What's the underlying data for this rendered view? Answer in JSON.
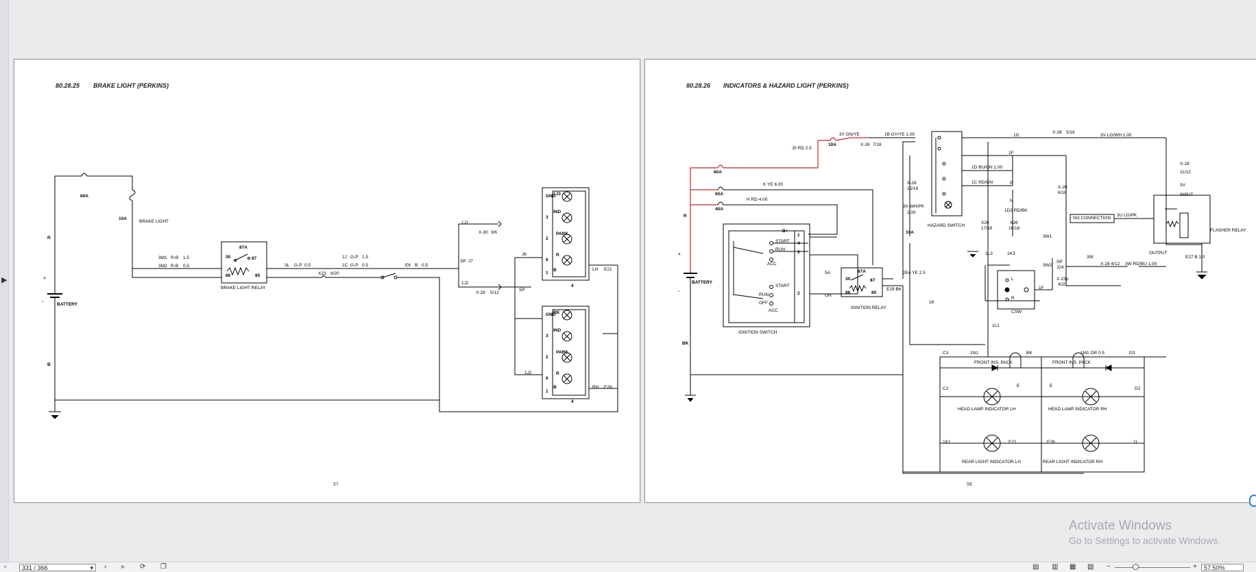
{
  "viewer": {
    "page_input": "331 / 366",
    "zoom": "57.50%"
  },
  "watermark": {
    "title": "Activate Windows",
    "subtitle": "Go to Settings to activate Windows."
  },
  "pages": [
    {
      "code": "80.28.25",
      "title": "BRAKE LIGHT (PERKINS)",
      "number": "57",
      "labels": [
        "60A",
        "10A",
        "BRAKE LIGHT",
        "R",
        "+",
        "-",
        "BATTERY",
        "B",
        "3M1",
        "R-B",
        "1.5",
        "3M2",
        "R-B",
        "0.5",
        "87A",
        "30",
        "87",
        "86",
        "85",
        "BRAKE LIGHT RELAY",
        "3L",
        "G-P",
        "0.5",
        "X23",
        "6/20",
        "1J",
        "G-P",
        "1.5",
        "1C",
        "G-P",
        "0.5",
        "E6",
        "B",
        "0.5",
        "1J1",
        "X-30",
        "3/6",
        "SP",
        "J7",
        "1J2",
        "X-28",
        "5/12",
        "SP",
        "J6",
        "1J2",
        "1J3",
        "IND",
        "PARK",
        "R",
        "B",
        "GND",
        "3",
        "2",
        "6",
        "1",
        "4",
        "LH",
        "E21",
        "BK",
        "IND",
        "PARK",
        "R",
        "B",
        "GND",
        "3",
        "2",
        "6",
        "1",
        "4",
        "RH",
        "E26",
        "BK"
      ]
    },
    {
      "code": "80.28.26",
      "title": "INDICATORS & HAZARD LIGHT (PERKINS)",
      "number": "58",
      "labels": [
        "3Y GN/YE",
        "1B GY/YE 1.00",
        "10A",
        "X-26",
        "7/18",
        "J5 RD 2.5",
        "60A",
        "K YE 6.00",
        "60A",
        "H RD 4.00",
        "40A",
        "R",
        "+",
        "-",
        "BATTERY",
        "BK",
        "B+",
        "START",
        "RUN",
        "ACC",
        "START",
        "RUN",
        "OFF",
        "ACC",
        "1",
        "4",
        "3",
        "2",
        "IGNITION SWITCH",
        "5A",
        "GN",
        "87A",
        "30",
        "87",
        "86",
        "85",
        "IGNITION RELAY",
        "E29 BK",
        "2E4 YE 2.5",
        "X-26",
        "15/18",
        "3X WH/PK",
        "1.00",
        "10A",
        "HAZARD SWITCH",
        "1D BU/GN 1.00",
        "1C RD/GN",
        "P",
        "N",
        "1D2 RD/BK",
        "X26",
        "17/18",
        "X26",
        "16/18",
        "1L3",
        "1K3",
        "1G",
        "1F",
        "X-26",
        "5/18",
        "3V LG/WH 1.00",
        "X-26",
        "6/18",
        "3W1",
        "3W2",
        "SP",
        "J24",
        "X-23p",
        "4/20",
        "1F",
        "L",
        "R",
        "CSW",
        "3W",
        "X-28 4/12",
        "3W RD/BU 1.00",
        "X-28",
        "11/12",
        "3V",
        "INPUT",
        "NO CONNECTION",
        "3U LG/PK",
        "FLASHER RELAY",
        "OUTPUT",
        "E27 B 1.0",
        "1K",
        "1L1",
        "C3",
        "1N1",
        "BK",
        "1M1 OR 0.5",
        "D3",
        "FRONT INS. PACK",
        "FRONT INS. PACK",
        "C2",
        "E",
        "E",
        "D2",
        "HEAD LAMP INDICATOR LH",
        "HEAD LAMP INDICATOR RH",
        "1K1",
        "E21",
        "E26",
        "1L",
        "REAR LIGHT INDICATOR LH",
        "REAR LIGHT INDICATOR RH"
      ]
    }
  ]
}
